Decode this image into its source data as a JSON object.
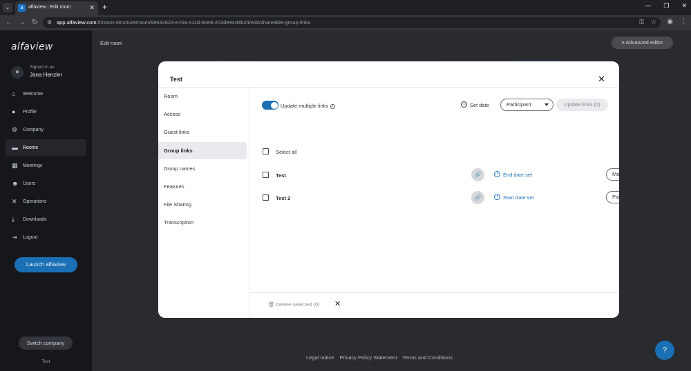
{
  "browser": {
    "tab_title": "alfaview - Edit room",
    "url_host": "app.alfaview.com",
    "url_path": "/#/room-structure/room/68532623-e15a-511d-b0e8-203de94d4b24/edit/shareable-group-links"
  },
  "sidebar": {
    "brand": "alfaview",
    "signed_in_label": "Signed in as",
    "user_name": "Jana Henzler",
    "items": [
      {
        "label": "Welcome",
        "icon": "home-icon"
      },
      {
        "label": "Profile",
        "icon": "person-icon"
      },
      {
        "label": "Company",
        "icon": "gear-icon"
      },
      {
        "label": "Rooms",
        "icon": "folder-icon"
      },
      {
        "label": "Meetings",
        "icon": "calendar-icon"
      },
      {
        "label": "Users",
        "icon": "users-icon"
      },
      {
        "label": "Operations",
        "icon": "tools-icon"
      },
      {
        "label": "Downloads",
        "icon": "download-icon"
      },
      {
        "label": "Logout",
        "icon": "logout-icon"
      }
    ],
    "active_item": "Rooms",
    "launch_label": "Launch alfaview",
    "switch_label": "Switch company",
    "footer_text": "Test"
  },
  "main": {
    "title": "Edit room",
    "advanced_editor_label": "Advanced editor",
    "footer_links": [
      "Legal notice",
      "Privacy Policy Statement",
      "Terms and Conditions"
    ]
  },
  "modal": {
    "title": "Test",
    "menu": [
      "Room",
      "Access",
      "Guest links",
      "Group links",
      "Group names",
      "Features",
      "File Sharing",
      "Transcription"
    ],
    "active_menu": "Group links",
    "toggle_label": "Update multiple links",
    "toggle_on": true,
    "set_date_label": "Set date",
    "role_select_value": "Participant",
    "update_links_label": "Update links (0)",
    "select_all_label": "Select all",
    "rows": [
      {
        "name": "Test",
        "date_label": "End date set",
        "role": "Moderator"
      },
      {
        "name": "Test 2",
        "date_label": "Start date set",
        "role": "Participant"
      }
    ],
    "delete_label": "Delete selected (0)"
  },
  "colors": {
    "accent": "#1a6fb5",
    "sidebar_bg": "#16171b"
  }
}
